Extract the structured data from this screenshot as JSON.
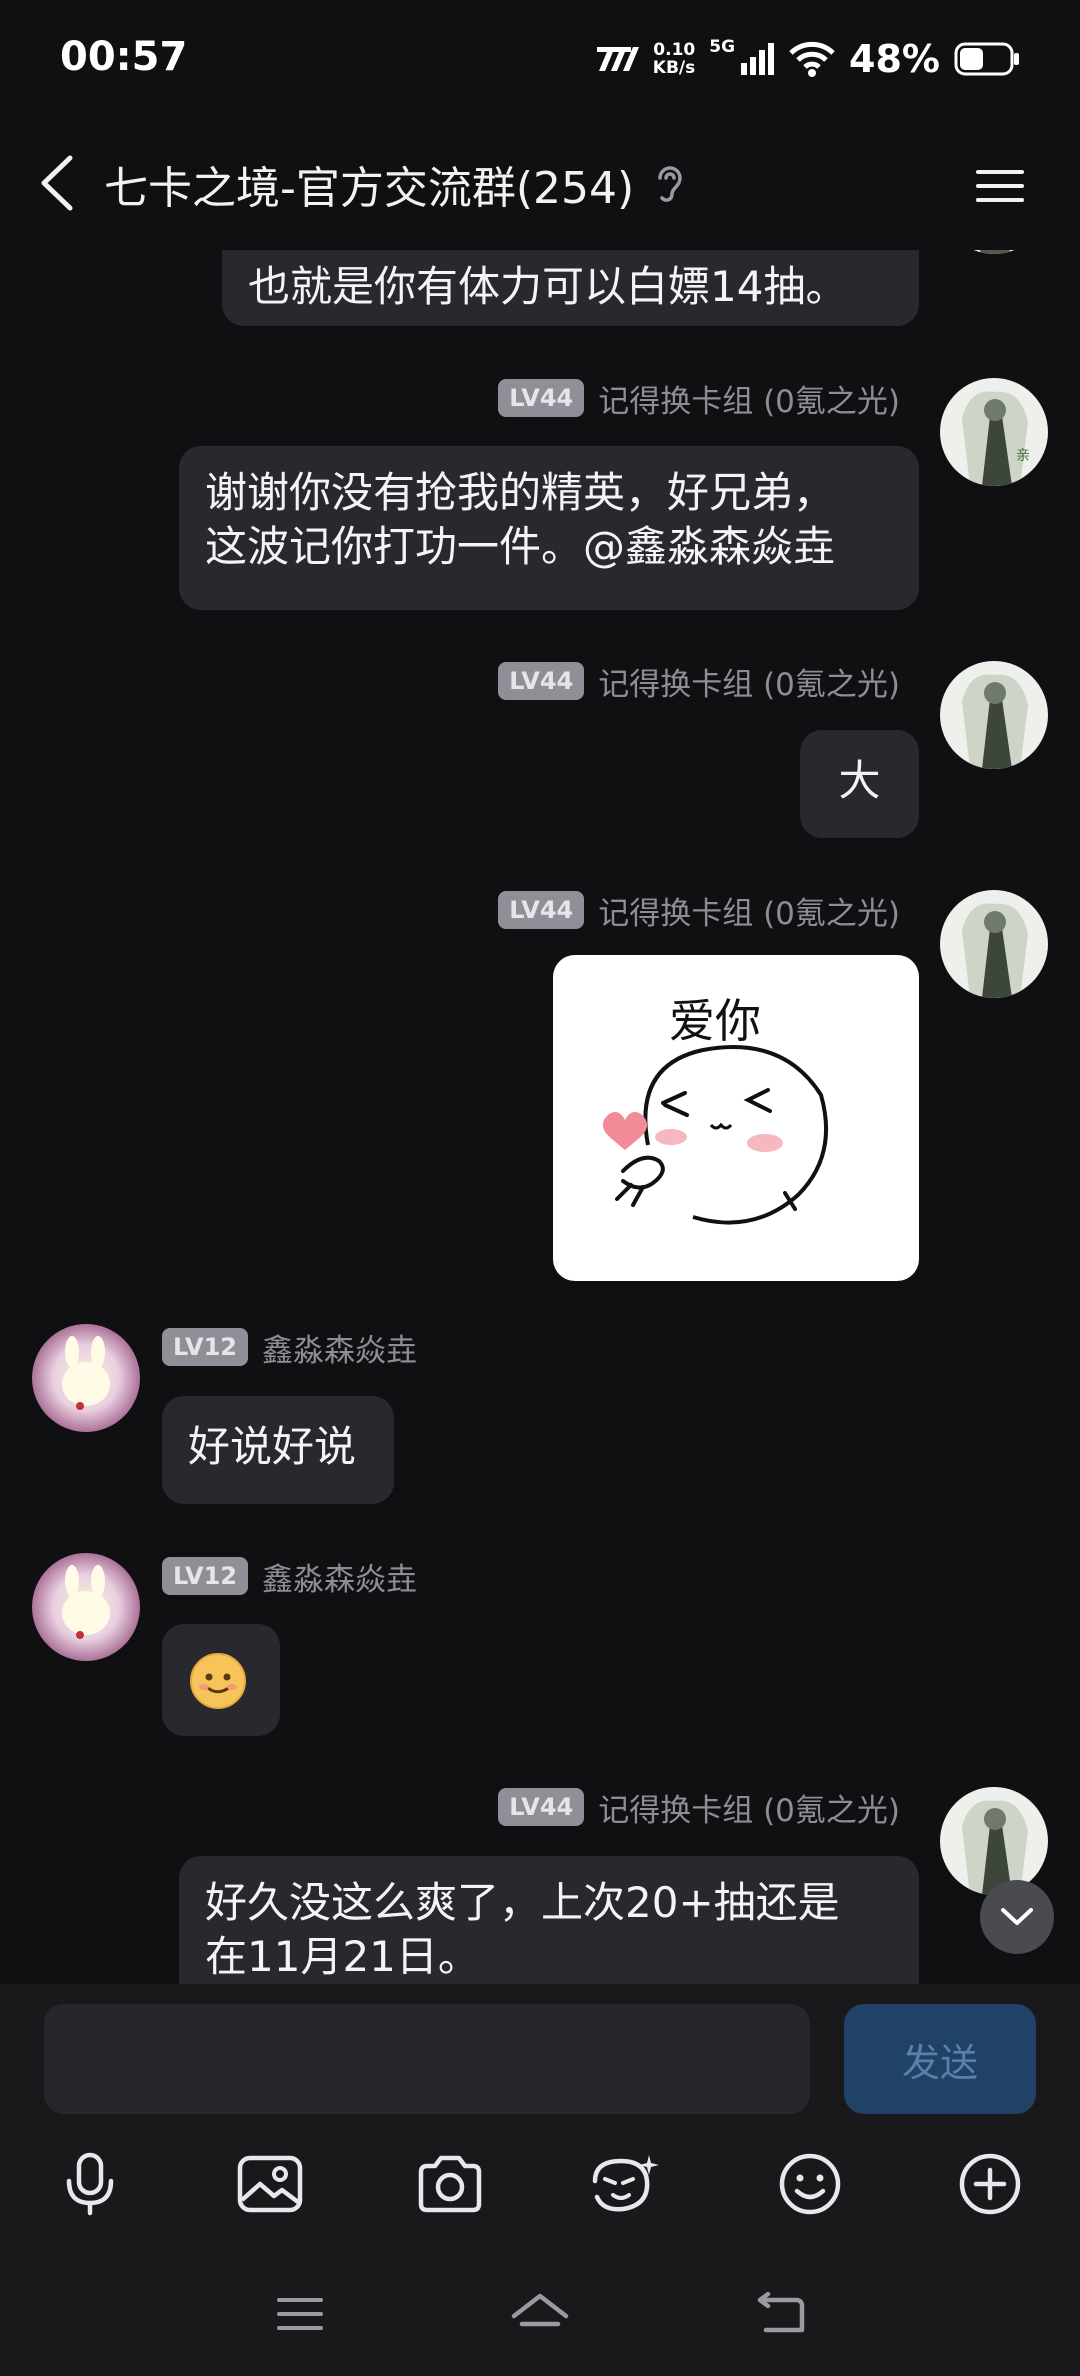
{
  "status_bar": {
    "time": "00:57",
    "network_speed_value": "0.10",
    "network_speed_unit": "KB/s",
    "network_type": "5G",
    "battery_percent": "48%",
    "battery_level": 0.48
  },
  "header": {
    "title": "七卡之境-官方交流群(254)"
  },
  "messages": [
    {
      "text_lines": [
        "也就是你有体力可以白嫖14抽。"
      ]
    },
    {
      "level": "LV44",
      "sender": "记得换卡组 (0氪之光)",
      "text_lines": [
        "谢谢你没有抢我的精英，好兄弟，",
        "这波记你打功一件。@鑫淼森焱垚"
      ]
    },
    {
      "level": "LV44",
      "sender": "记得换卡组 (0氪之光)",
      "text_lines": [
        "大"
      ]
    },
    {
      "level": "LV44",
      "sender": "记得换卡组 (0氪之光)",
      "sticker_caption": "爱你"
    },
    {
      "level": "LV12",
      "sender": "鑫淼森焱垚",
      "text_lines": [
        "好说好说"
      ]
    },
    {
      "level": "LV12",
      "sender": "鑫淼森焱垚",
      "emoji": "slightly-smiling-face"
    },
    {
      "level": "LV44",
      "sender": "记得换卡组 (0氪之光)",
      "text_lines": [
        "好久没这么爽了，上次20+抽还是",
        "在11月21日。"
      ]
    }
  ],
  "input": {
    "placeholder": "",
    "value": "",
    "send_label": "发送"
  },
  "toolbar_icons": [
    "microphone-icon",
    "image-icon",
    "camera-icon",
    "sticker-icon",
    "emoji-icon",
    "plus-icon"
  ],
  "nav_icons": [
    "menu-icon",
    "home-icon",
    "back-icon"
  ],
  "colors": {
    "background": "#101013",
    "bubble": "#27292e",
    "level_badge": "#8f9097",
    "send_button": "#1f4266",
    "send_text": "#5a7fa8"
  }
}
